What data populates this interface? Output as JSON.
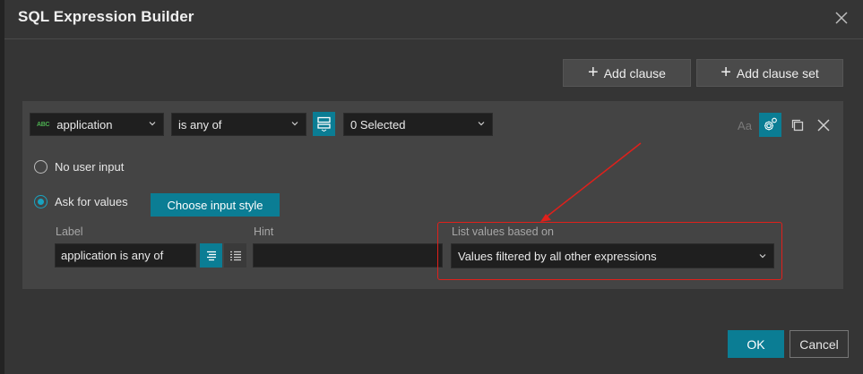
{
  "dialog": {
    "title": "SQL Expression Builder",
    "close_icon": "close-icon"
  },
  "toolbar": {
    "add_clause_label": "Add clause",
    "add_clause_set_label": "Add clause set",
    "plus_icon": "plus-icon"
  },
  "clause": {
    "field": {
      "type_badge": "ABC",
      "value": "application"
    },
    "operator": {
      "value": "is any of"
    },
    "value_mode_icon": "list-mode-icon",
    "values": {
      "value": "0 Selected"
    },
    "actions": {
      "case_sensitive_label": "Aa",
      "settings_icon": "gear-icon",
      "duplicate_icon": "copy-icon",
      "remove_icon": "close-icon"
    },
    "input_options": {
      "no_user_input_label": "No user input",
      "ask_for_values_label": "Ask for values",
      "selected": "Ask for values",
      "choose_input_style_label": "Choose input style"
    },
    "label_field": {
      "title": "Label",
      "value": "application is any of"
    },
    "hint_field": {
      "title": "Hint",
      "value": ""
    },
    "list_values": {
      "title": "List values based on",
      "value": "Values filtered by all other expressions"
    }
  },
  "footer": {
    "ok_label": "OK",
    "cancel_label": "Cancel"
  },
  "colors": {
    "accent": "#0b7d94",
    "radio_selected": "#19a3c0",
    "highlight_box": "#e0201b",
    "dialog_bg": "#353535",
    "panel_bg": "#444444"
  }
}
